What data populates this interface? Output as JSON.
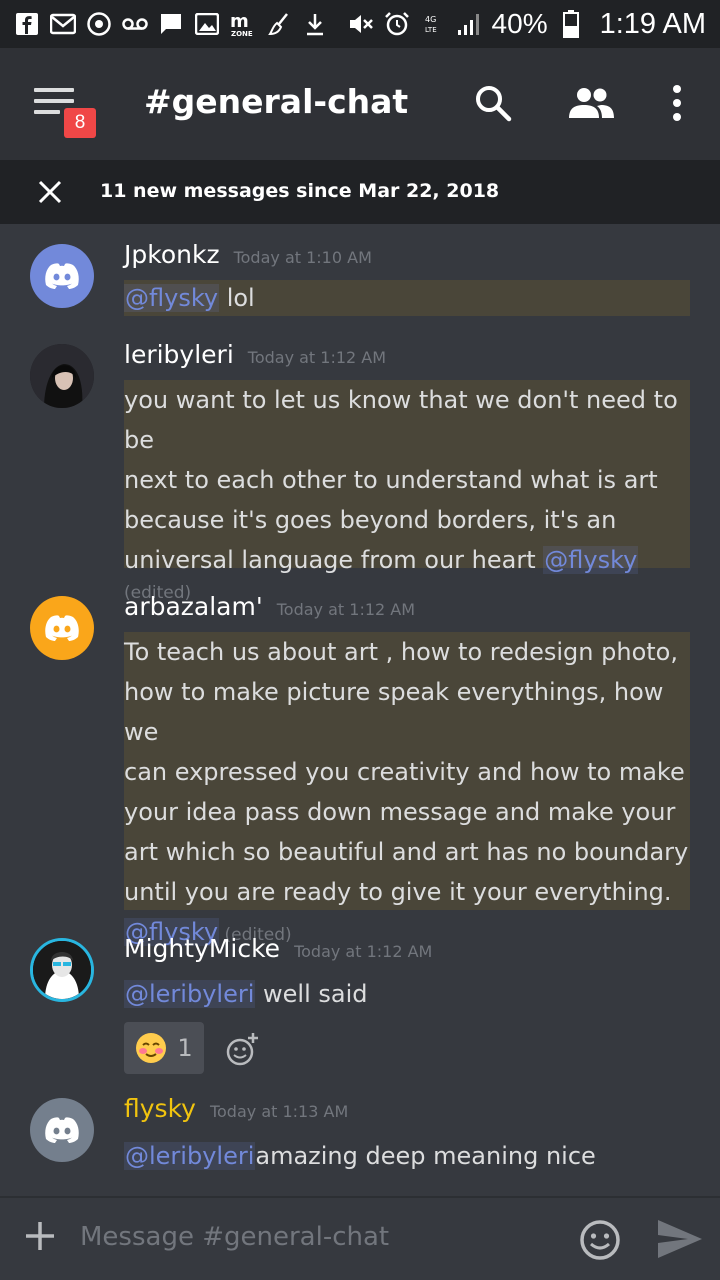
{
  "status_bar": {
    "battery": "40%",
    "time": "1:19 AM"
  },
  "app_bar": {
    "menu_badge": "8",
    "channel": "#general-chat"
  },
  "new_messages_bar": {
    "text": "11 new messages since Mar 22, 2018"
  },
  "messages": [
    {
      "username": "Jpkonkz",
      "timestamp": "Today at 1:10 AM",
      "mention": "@flysky",
      "text": " lol"
    },
    {
      "username": "leribyleri",
      "timestamp": "Today at 1:12 AM",
      "lines": [
        "you want to let us know that we don't need to be",
        "next to each other to understand what is art",
        "because it's goes beyond borders, it's an",
        "universal language from our heart "
      ],
      "mention": "@flysky",
      "edited": "(edited)"
    },
    {
      "username": "arbazalam'",
      "timestamp": "Today at 1:12 AM",
      "lines": [
        "To teach us about art , how to redesign photo,",
        "how to make picture speak everythings, how we",
        "can expressed you creativity and how to make",
        "your idea pass down message and make your",
        "art which so beautiful  and art has no boundary",
        "until you are ready to give it your everything."
      ],
      "mention": "@flysky",
      "edited": " (edited)"
    },
    {
      "username": "MightyMicke",
      "timestamp": "Today at 1:12 AM",
      "mention": "@leribyleri",
      "text": " well said",
      "reaction_count": "1"
    },
    {
      "username": "flysky",
      "timestamp": "Today at 1:13 AM",
      "mention": "@leribyleri",
      "text": "amazing deep meaning nice"
    }
  ],
  "input": {
    "placeholder": "Message #general-chat"
  },
  "colors": {
    "background": "#36393f",
    "mention_highlight": "#4a4639",
    "mention_text": "#7289da",
    "badge": "#f04747",
    "flysky_name": "#f1c40f"
  }
}
